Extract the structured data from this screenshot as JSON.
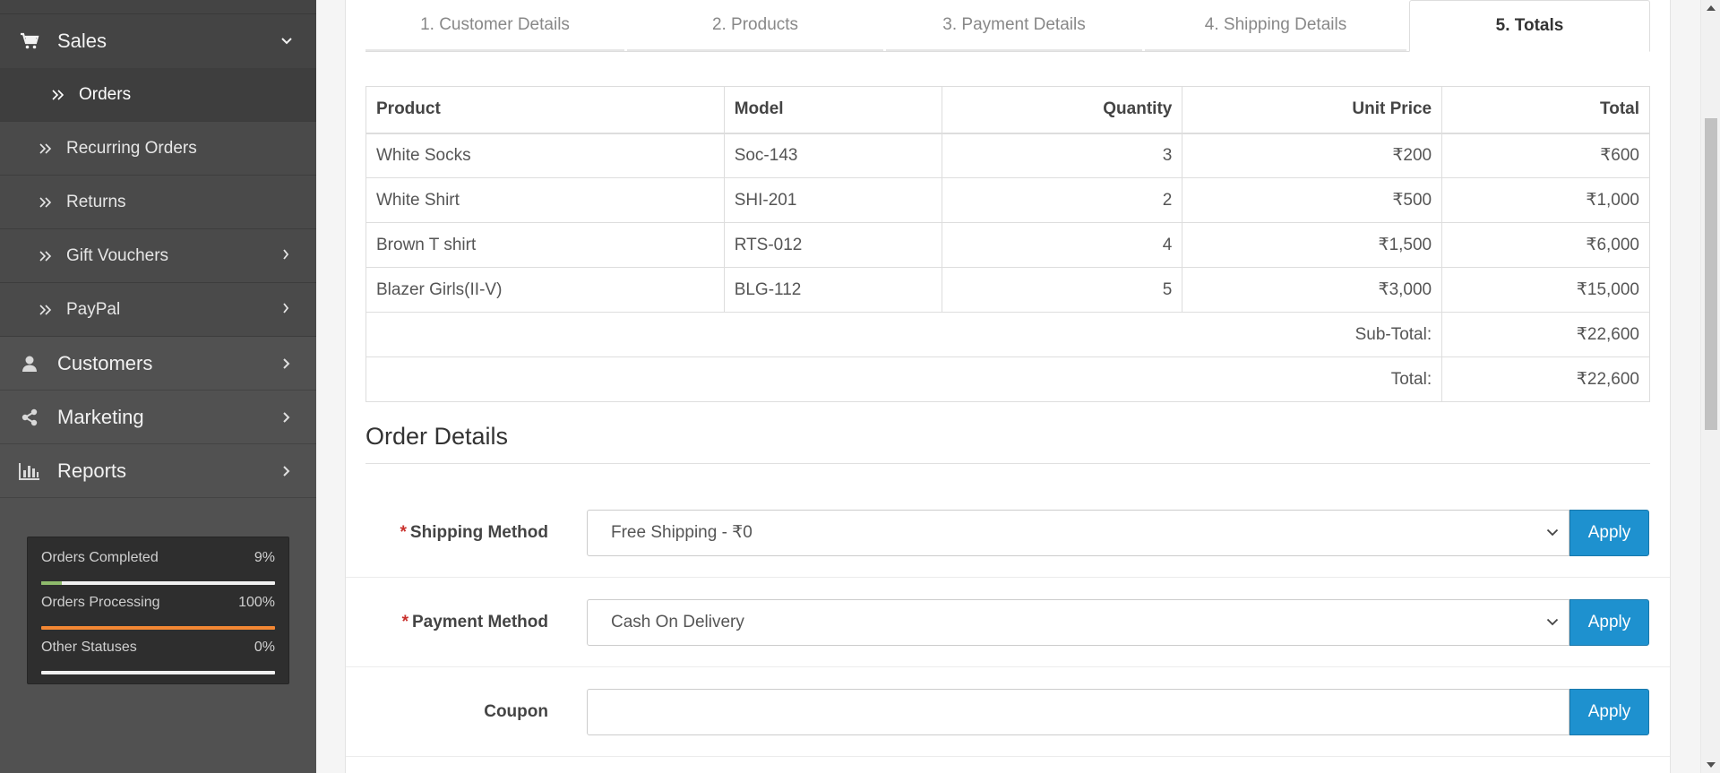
{
  "sidebar": {
    "sales": {
      "label": "Sales",
      "icon": "cart-icon"
    },
    "orders": {
      "label": "Orders"
    },
    "recurring_orders": {
      "label": "Recurring Orders"
    },
    "returns": {
      "label": "Returns"
    },
    "gift_vouchers": {
      "label": "Gift Vouchers"
    },
    "paypal": {
      "label": "PayPal"
    },
    "customers": {
      "label": "Customers",
      "icon": "user-icon"
    },
    "marketing": {
      "label": "Marketing",
      "icon": "share-icon"
    },
    "reports": {
      "label": "Reports",
      "icon": "bar-chart-icon"
    },
    "stats": [
      {
        "label": "Orders Completed",
        "value": "9%",
        "percent": 9,
        "color": "#8fbb6c"
      },
      {
        "label": "Orders Processing",
        "value": "100%",
        "percent": 100,
        "color": "#f38733"
      },
      {
        "label": "Other Statuses",
        "value": "0%",
        "percent": 0,
        "color": "#e8e8e8"
      }
    ]
  },
  "tabs": [
    {
      "label": "1. Customer Details"
    },
    {
      "label": "2. Products"
    },
    {
      "label": "3. Payment Details"
    },
    {
      "label": "4. Shipping Details"
    },
    {
      "label": "5. Totals"
    }
  ],
  "table": {
    "headers": {
      "product": "Product",
      "model": "Model",
      "quantity": "Quantity",
      "unit_price": "Unit Price",
      "total": "Total"
    },
    "rows": [
      {
        "product": "White Socks",
        "model": "Soc-143",
        "quantity": "3",
        "unit_price": "₹200",
        "total": "₹600"
      },
      {
        "product": "White Shirt",
        "model": "SHI-201",
        "quantity": "2",
        "unit_price": "₹500",
        "total": "₹1,000"
      },
      {
        "product": "Brown T shirt",
        "model": "RTS-012",
        "quantity": "4",
        "unit_price": "₹1,500",
        "total": "₹6,000"
      },
      {
        "product": "Blazer Girls(II-V)",
        "model": "BLG-112",
        "quantity": "5",
        "unit_price": "₹3,000",
        "total": "₹15,000"
      }
    ],
    "subtotal_label": "Sub-Total:",
    "subtotal_value": "₹22,600",
    "total_label": "Total:",
    "total_value": "₹22,600"
  },
  "order_details": {
    "title": "Order Details",
    "required_mark": "*",
    "shipping_method": {
      "label": "Shipping Method",
      "value": "Free Shipping - ₹0",
      "button": "Apply"
    },
    "payment_method": {
      "label": "Payment Method",
      "value": "Cash On Delivery",
      "button": "Apply"
    },
    "coupon": {
      "label": "Coupon",
      "value": "",
      "button": "Apply"
    }
  },
  "colors": {
    "accent": "#1e91cf",
    "required": "#c9302c"
  }
}
